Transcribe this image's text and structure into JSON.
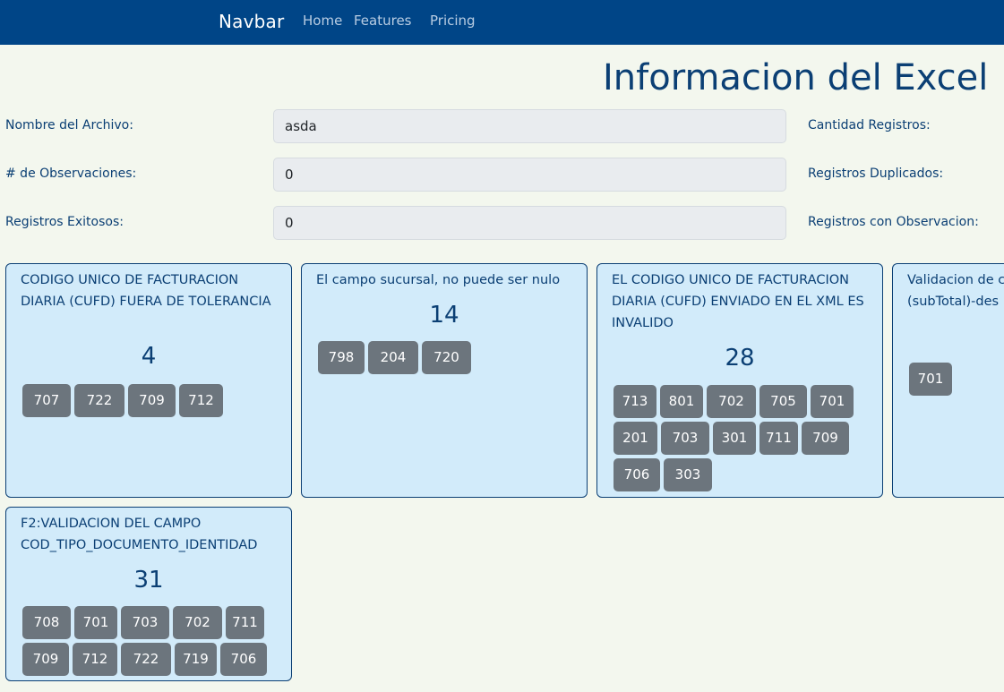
{
  "navbar": {
    "brand": "Navbar",
    "links": [
      "Home",
      "Features",
      "Pricing"
    ]
  },
  "page_title": "Informacion del Excel",
  "form": {
    "file_name_label": "Nombre del Archivo:",
    "file_name_value": "asda",
    "observations_label": "# de Observaciones:",
    "observations_value": "0",
    "success_label": "Registros Exitosos:",
    "success_value": "0",
    "total_label": "Cantidad Registros:",
    "duplicates_label": "Registros Duplicados:",
    "with_obs_label": "Registros con Observacion:"
  },
  "cards": [
    {
      "title": "CODIGO UNICO DE FACTURACION DIARIA (CUFD) FUERA DE TOLERANCIA",
      "count": "4",
      "chips": [
        "707",
        "722",
        "709",
        "712"
      ]
    },
    {
      "title": "El campo sucursal, no puede ser nulo",
      "count": "14",
      "chips": [
        "798",
        "204",
        "720"
      ]
    },
    {
      "title": "EL CODIGO UNICO DE FACTURACION DIARIA (CUFD) ENVIADO EN EL XML ES INVALIDO",
      "count": "28",
      "chips": [
        "713",
        "801",
        "702",
        "705",
        "701",
        "201",
        "703",
        "301",
        "711",
        "709",
        "706",
        "303"
      ]
    },
    {
      "title": "Validacion de c (subTotal)-des",
      "count": "",
      "chips": [
        "701"
      ]
    },
    {
      "title": "F2:VALIDACION DEL CAMPO COD_TIPO_DOCUMENTO_IDENTIDAD",
      "count": "31",
      "chips": [
        "708",
        "701",
        "703",
        "702",
        "711",
        "709",
        "712",
        "722",
        "719",
        "706"
      ]
    }
  ],
  "colors": {
    "navbar": "#004587",
    "background": "#f3f7ee",
    "card_bg": "#d2ebfa",
    "chip_bg": "#6c757d",
    "text": "#0b3f74"
  }
}
